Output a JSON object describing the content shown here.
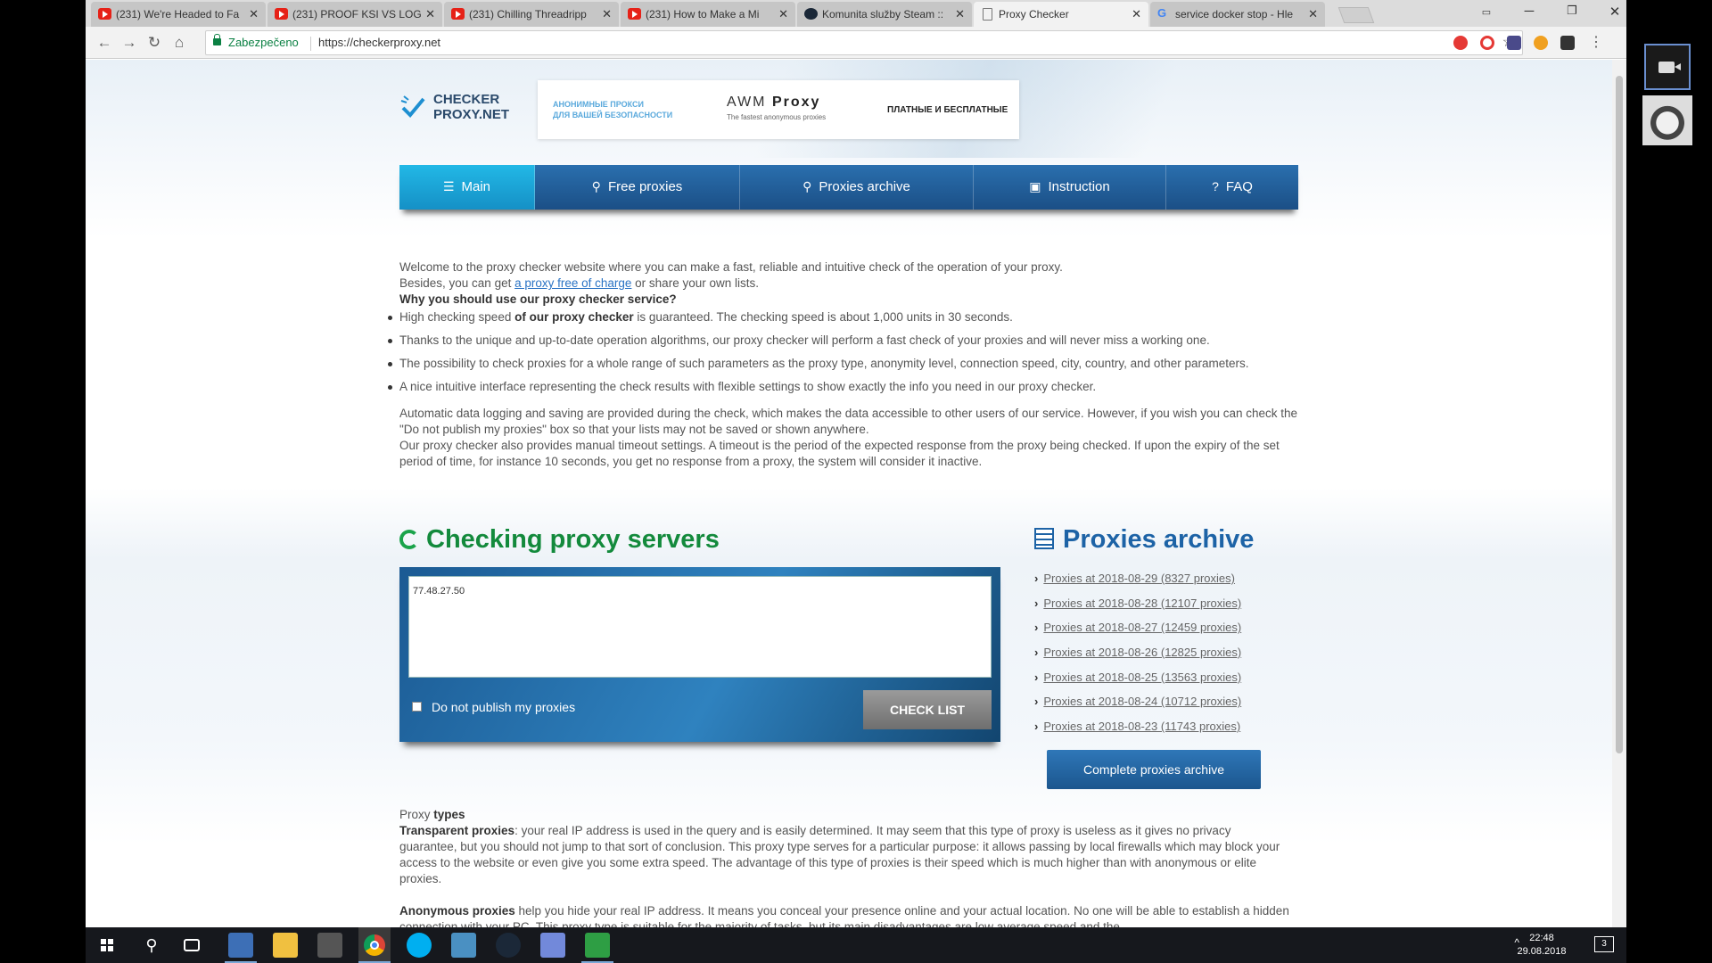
{
  "browser": {
    "tabs": [
      {
        "title": "(231) We're Headed to Fa",
        "favicon": "youtube-icon"
      },
      {
        "title": "(231) PROOF KSI VS LOG",
        "favicon": "youtube-icon"
      },
      {
        "title": "(231) Chilling Threadripp",
        "favicon": "youtube-icon"
      },
      {
        "title": "(231) How to Make a Mi",
        "favicon": "youtube-icon"
      },
      {
        "title": "Komunita služby Steam ::",
        "favicon": "steam-icon"
      },
      {
        "title": "Proxy Checker",
        "favicon": "document-icon"
      },
      {
        "title": "service docker stop - Hle",
        "favicon": "google-icon"
      }
    ],
    "active_tab": 5,
    "secure_label": "Zabezpečeno",
    "url": "https://checkerproxy.net"
  },
  "site": {
    "logo_line1": "CHECKER",
    "logo_line2": "PROXY.NET",
    "banner": {
      "left_line1": "АНОНИМНЫЕ ПРОКСИ",
      "left_line2": "ДЛЯ ВАШЕЙ БЕЗОПАСНОСТИ",
      "brand_a": "AWM",
      "brand_b": "Proxy",
      "tagline": "The fastest anonymous proxies",
      "right": "ПЛАТНЫЕ И БЕСПЛАТНЫЕ"
    },
    "nav": [
      {
        "label": "Main",
        "icon": "menu-icon"
      },
      {
        "label": "Free proxies",
        "icon": "search-icon"
      },
      {
        "label": "Proxies archive",
        "icon": "search-icon"
      },
      {
        "label": "Instruction",
        "icon": "book-icon"
      },
      {
        "label": "FAQ",
        "icon": "question-icon"
      }
    ]
  },
  "intro": {
    "p1": "Welcome to the proxy checker website where you can make a fast, reliable and intuitive check of the operation of your proxy.",
    "p2_pre": "Besides, you can get ",
    "p2_link": "a proxy free of charge",
    "p2_post": " or share your own lists.",
    "why": "Why you should use our proxy checker service?",
    "f1_pre": "High checking speed ",
    "f1_bold": "of our proxy checker",
    "f1_post": " is guaranteed. The checking speed is about 1,000 units in 30 seconds.",
    "f2": "Thanks to the unique and up-to-date operation algorithms, our proxy checker will perform a fast check of your proxies and will never miss a working one.",
    "f3": "The possibility to check proxies for a whole range of such parameters as the proxy type, anonymity level, connection speed, city, country, and other parameters.",
    "f4": "A nice intuitive interface representing the check results with flexible settings to show exactly the info you need in our proxy checker.",
    "p3": "Automatic data logging and saving are provided during the check, which makes the data accessible to other users of our service. However, if you wish you can check the \"Do not publish my proxies\" box so that your lists may not be saved or shown anywhere.",
    "p4": "Our proxy checker also provides manual timeout settings. A timeout is the period of the expected response from the proxy being checked. If upon the expiry of the set period of time, for instance 10 seconds, you get no response from a proxy, the system will consider it inactive."
  },
  "checker": {
    "title": "Checking proxy servers",
    "input_value": "77.48.27.50",
    "no_publish_label": "Do not publish my proxies",
    "check_button": "CHECK LIST"
  },
  "archive": {
    "title": "Proxies archive",
    "items": [
      "Proxies at 2018-08-29 (8327 proxies)",
      "Proxies at 2018-08-28 (12107 proxies)",
      "Proxies at 2018-08-27 (12459 proxies)",
      "Proxies at 2018-08-26 (12825 proxies)",
      "Proxies at 2018-08-25 (13563 proxies)",
      "Proxies at 2018-08-24 (10712 proxies)",
      "Proxies at 2018-08-23 (11743 proxies)"
    ],
    "complete_button": "Complete proxies archive"
  },
  "types": {
    "heading_pre": "Proxy ",
    "heading_bold": "types",
    "transparent_bold": "Transparent proxies",
    "transparent_text": ": your real IP address is used in the query and is easily determined. It may seem that this type of proxy is useless as it gives no privacy guarantee, but you should not jump to that sort of conclusion. This proxy type serves for a particular purpose: it allows passing by local firewalls which may block your access to the website or even give you some extra speed. The advantage of this type of proxies is their speed which is much higher than with anonymous or elite proxies.",
    "anonymous_bold": "Anonymous proxies",
    "anonymous_text": " help you hide your real IP address. It means you conceal your presence online and your actual location. No one will be able to establish a hidden connection with your PC. This proxy type is suitable for the majority of tasks, but its main disadvantages are low average speed and the"
  },
  "taskbar": {
    "time": "22:48",
    "date": "29.08.2018",
    "notification_count": "3"
  },
  "colors": {
    "nav_blue": "#1b4f86",
    "nav_active": "#22b8e6",
    "check_green": "#138a3c",
    "archive_blue": "#1d63a6"
  }
}
